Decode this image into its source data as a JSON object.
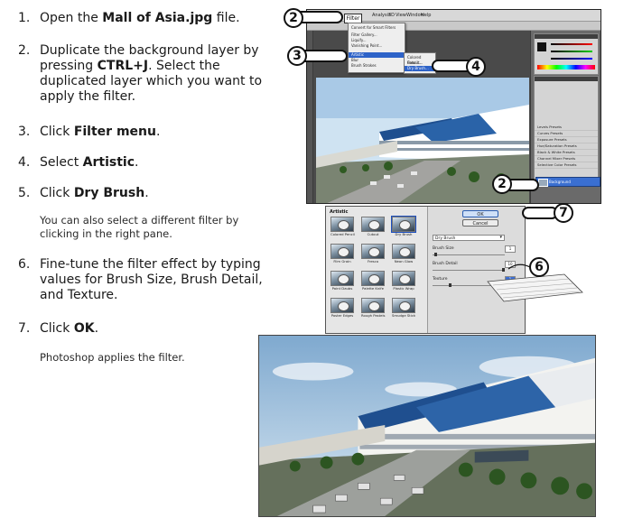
{
  "steps": [
    {
      "num": "1.",
      "pre": "Open the ",
      "bold": "Mall of Asia.jpg",
      "post": " file."
    },
    {
      "num": "2.",
      "pre": "Duplicate the background layer by pressing ",
      "bold": "CTRL+J",
      "post": ". Select the duplicated layer which you want to apply the filter."
    },
    {
      "num": "3.",
      "pre": "Click ",
      "bold": "Filter menu",
      "post": "."
    },
    {
      "num": "4.",
      "pre": "Select ",
      "bold": "Artistic",
      "post": "."
    },
    {
      "num": "5.",
      "pre": "Click ",
      "bold": "Dry Brush",
      "post": "."
    },
    {
      "num": "6.",
      "pre": "Fine-tune the filter effect by typing values for Brush Size, Brush Detail, and Texture.",
      "bold": "",
      "post": ""
    },
    {
      "num": "7.",
      "pre": "Click ",
      "bold": "OK",
      "post": "."
    }
  ],
  "notes": {
    "after_step5": "You can also select a different filter by clicking in the right pane.",
    "after_step7": "Photoshop applies the filter."
  },
  "callouts": {
    "top_filter": "2",
    "submenu": "3",
    "artistic": "4",
    "layer": "2",
    "values": "6",
    "ok": "7"
  },
  "ps_window": {
    "filter_menu_label": "Filter",
    "menubar_items": [
      "Analysis",
      "3D",
      "View",
      "Window",
      "Help"
    ],
    "filter_menu_items": [
      "Convert for Smart Filters",
      "Filter Gallery...",
      "Liquify...",
      "Vanishing Point...",
      "Artistic",
      "Blur",
      "Brush Strokes"
    ],
    "artistic_submenu": [
      "Colored Pencil...",
      "Cutout...",
      "Dry Brush..."
    ],
    "adjust_panel_items": [
      "Levels Presets",
      "Curves Presets",
      "Exposure Presets",
      "Hue/Saturation Presets",
      "Black & White Presets",
      "Channel Mixer Presets",
      "Selective Color Presets"
    ],
    "layer_name": "Background"
  },
  "filter_gallery": {
    "category": "Artistic",
    "thumbs": [
      "Colored Pencil",
      "Cutout",
      "Dry Brush",
      "Film Grain",
      "Fresco",
      "Neon Glow",
      "Paint Daubs",
      "Palette Knife",
      "Plastic Wrap",
      "Poster Edges",
      "Rough Pastels",
      "Smudge Stick"
    ],
    "ok_label": "OK",
    "cancel_label": "Cancel",
    "filter_select": "Dry Brush",
    "params": [
      {
        "label": "Brush Size",
        "value": "1"
      },
      {
        "label": "Brush Detail",
        "value": "10"
      },
      {
        "label": "Texture",
        "value": "1"
      }
    ]
  },
  "colors": {
    "highlight": "#2e63c8",
    "sky": "#cfe3f2",
    "building_blue": "#1f4f8f"
  }
}
